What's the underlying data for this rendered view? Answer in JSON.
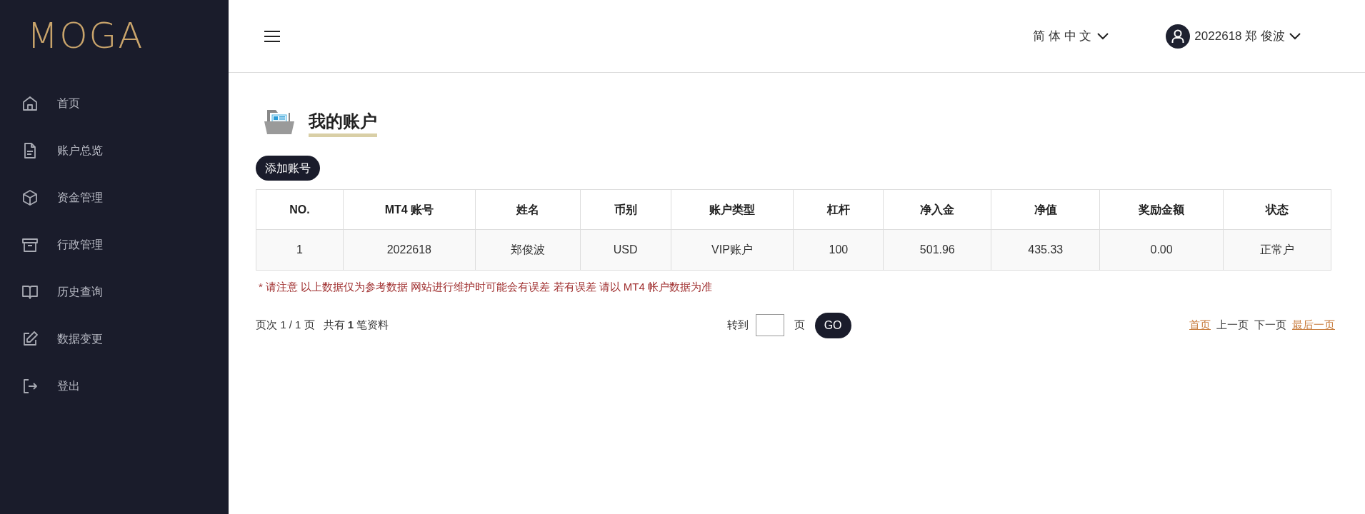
{
  "logo": {
    "text": "MOGA"
  },
  "sidebar": {
    "items": [
      {
        "label": "首页",
        "kind": "home"
      },
      {
        "label": "账户总览",
        "kind": "document"
      },
      {
        "label": "资金管理",
        "kind": "cube"
      },
      {
        "label": "行政管理",
        "kind": "archive"
      },
      {
        "label": "历史查询",
        "kind": "book"
      },
      {
        "label": "数据变更",
        "kind": "edit"
      },
      {
        "label": "登出",
        "kind": "logout"
      }
    ]
  },
  "header": {
    "language": "简 体 中 文",
    "user": "2022618 郑 俊波"
  },
  "page_title": "我的账户",
  "add_button": "添加账号",
  "table": {
    "columns": [
      "NO.",
      "MT4 账号",
      "姓名",
      "币别",
      "账户类型",
      "杠杆",
      "净入金",
      "净值",
      "奖励金额",
      "状态"
    ],
    "rows": [
      [
        "1",
        "2022618",
        "郑俊波",
        "USD",
        "VIP账户",
        "100",
        "501.96",
        "435.33",
        "0.00",
        "正常户"
      ]
    ]
  },
  "notice": "* 请注意 以上数据仅为参考数据 网站进行维护时可能会有误差 若有误差 请以 MT4 帐户数据为准",
  "pagination": {
    "page_info": "页次 1 / 1 页",
    "total": "共有 **1** 笔资料",
    "goto_label": "转到",
    "page_unit": "页",
    "go_button": "GO",
    "links": [
      {
        "label": "首页",
        "disabled": false
      },
      {
        "label": "上一页",
        "disabled": true
      },
      {
        "label": "下一页",
        "disabled": true
      },
      {
        "label": "最后一页",
        "disabled": false
      }
    ]
  }
}
